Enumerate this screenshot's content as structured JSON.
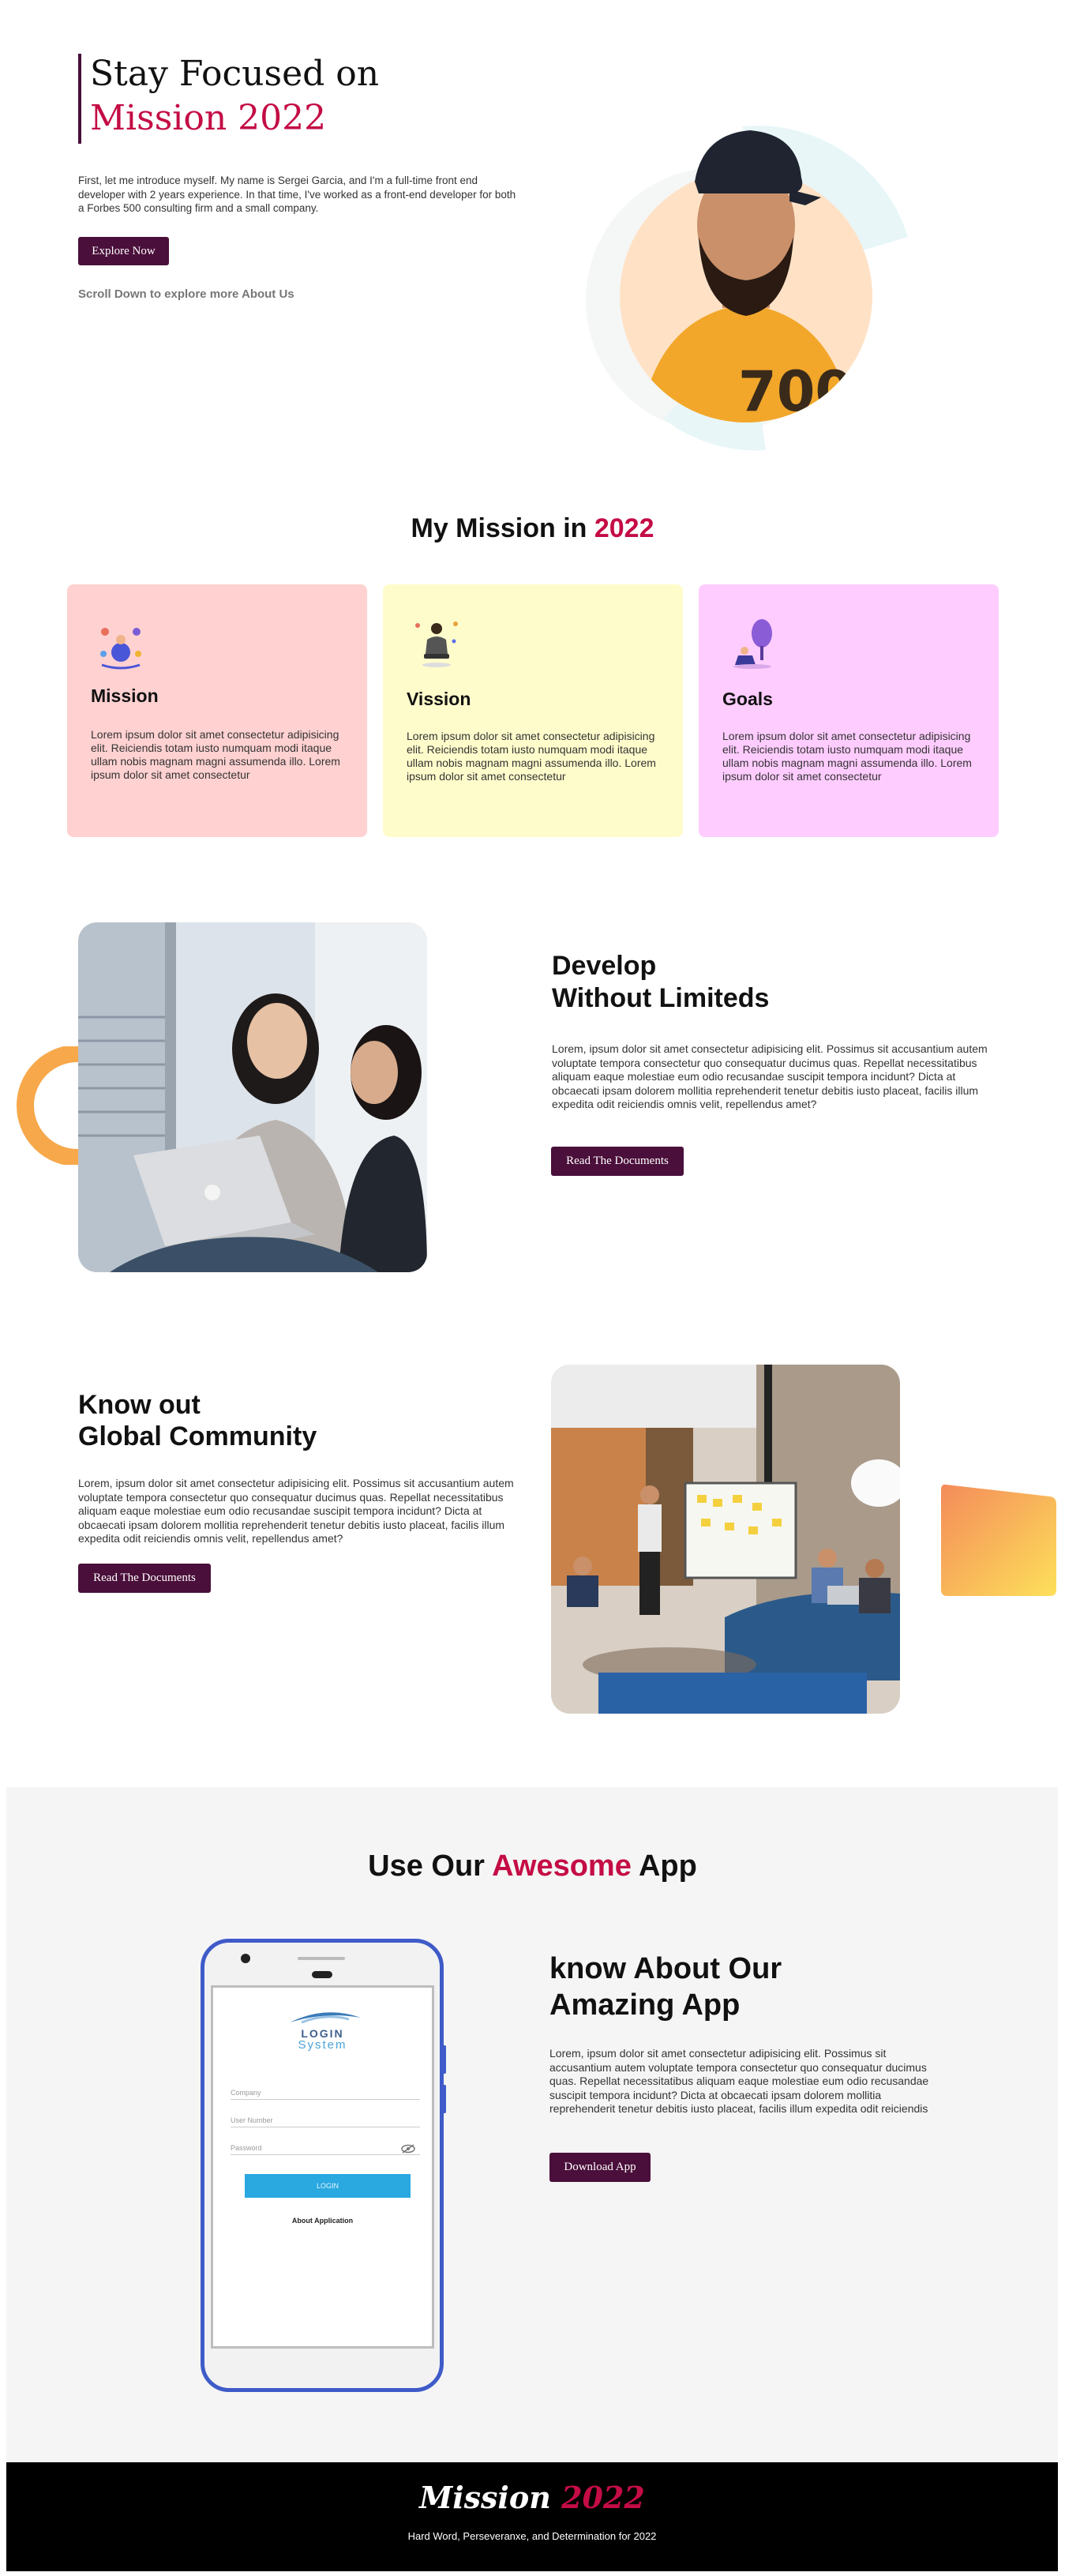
{
  "hero": {
    "title_line1": "Stay Focused on",
    "title_line2": "Mission 2022",
    "intro": "First, let me introduce myself. My name is Sergei Garcia, and I'm a full-time front end developer with 2 years experience. In that time, I've worked as a front-end developer for both a Forbes 500 consulting firm and a small company.",
    "cta_label": "Explore Now",
    "scroll_hint": "Scroll Down to explore more About Us"
  },
  "mission": {
    "heading_prefix": "My Mission in ",
    "heading_year": "2022",
    "cards": [
      {
        "title": "Mission",
        "text": "Lorem ipsum dolor sit amet consectetur adipisicing elit. Reiciendis totam iusto numquam modi itaque ullam nobis magnam magni assumenda illo. Lorem ipsum dolor sit amet consectetur",
        "color": "#ffd1d1"
      },
      {
        "title": "Vission",
        "text": "Lorem ipsum dolor sit amet consectetur adipisicing elit. Reiciendis totam iusto numquam modi itaque ullam nobis magnam magni assumenda illo. Lorem ipsum dolor sit amet consectetur",
        "color": "#fffccb"
      },
      {
        "title": "Goals",
        "text": "Lorem ipsum dolor sit amet consectetur adipisicing elit. Reiciendis totam iusto numquam modi itaque ullam nobis magnam magni assumenda illo. Lorem ipsum dolor sit amet consectetur",
        "color": "#ffccff"
      }
    ]
  },
  "develop": {
    "title_line1": "Develop",
    "title_line2": "Without Limiteds",
    "text": "Lorem, ipsum dolor sit amet consectetur adipisicing elit. Possimus sit accusantium autem voluptate tempora consectetur quo consequatur ducimus quas. Repellat necessitatibus aliquam eaque molestiae eum odio recusandae suscipit tempora incidunt? Dicta at obcaecati ipsam dolorem mollitia reprehenderit tenetur debitis iusto placeat, facilis illum expedita odit reiciendis omnis velit, repellendus amet?",
    "cta_label": "Read The Documents"
  },
  "community": {
    "title_line1": "Know out",
    "title_line2": "Global Community",
    "text": "Lorem, ipsum dolor sit amet consectetur adipisicing elit. Possimus sit accusantium autem voluptate tempora consectetur quo consequatur ducimus quas. Repellat necessitatibus aliquam eaque molestiae eum odio recusandae suscipit tempora incidunt? Dicta at obcaecati ipsam dolorem mollitia reprehenderit tenetur debitis iusto placeat, facilis illum expedita odit reiciendis omnis velit, repellendus amet?",
    "cta_label": "Read The Documents"
  },
  "app": {
    "heading_prefix": "Use Our ",
    "heading_accent": "Awesome",
    "heading_suffix": " App",
    "title_line1": "know About Our",
    "title_line2": "Amazing App",
    "text": "Lorem, ipsum dolor sit amet consectetur adipisicing elit. Possimus sit accusantium autem voluptate tempora consectetur quo consequatur ducimus quas. Repellat necessitatibus aliquam eaque molestiae eum odio recusandae suscipit tempora incidunt? Dicta at obcaecati ipsam dolorem mollitia reprehenderit tenetur debitis iusto placeat, facilis illum expedita odit reiciendis",
    "cta_label": "Download App",
    "phone": {
      "logo_line1": "LOGIN",
      "logo_line2": "System",
      "company_placeholder": "Company",
      "user_placeholder": "User Number",
      "password_placeholder": "Password",
      "login_label": "LOGIN",
      "about_label": "About Application"
    }
  },
  "footer": {
    "brand_word": "Mission",
    "brand_year": "2022",
    "tagline": "Hard Word, Perseveranxe, and Determination for 2022"
  },
  "colors": {
    "accent": "#c40c45",
    "button": "#4a0f3a",
    "footer_bg": "#000000",
    "app_section_bg": "#f5f5f5"
  }
}
